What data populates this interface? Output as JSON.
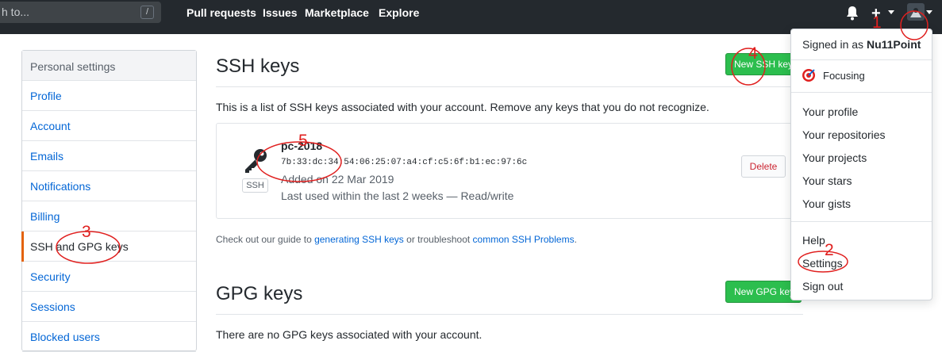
{
  "topbar": {
    "search_placeholder": "h to...",
    "search_shortcut": "/",
    "nav": [
      "Pull requests",
      "Issues",
      "Marketplace",
      "Explore"
    ]
  },
  "sidebar": {
    "heading": "Personal settings",
    "items": [
      "Profile",
      "Account",
      "Emails",
      "Notifications",
      "Billing",
      "SSH and GPG keys",
      "Security",
      "Sessions",
      "Blocked users"
    ],
    "active_index": 5
  },
  "ssh": {
    "title": "SSH keys",
    "new_button": "New SSH key",
    "description": "This is a list of SSH keys associated with your account. Remove any keys that you do not recognize.",
    "key": {
      "badge": "SSH",
      "title": "pc-2018",
      "fingerprint": "7b:33:dc:34:54:06:25:07:a4:cf:c5:6f:b1:ec:97:6c",
      "added": "Added on 22 Mar 2019",
      "last_used": "Last used within the last 2 weeks — Read/write",
      "delete_label": "Delete"
    },
    "guide": {
      "prefix": "Check out our guide to ",
      "link1": "generating SSH keys",
      "middle": " or troubleshoot ",
      "link2": "common SSH Problems",
      "suffix": "."
    }
  },
  "gpg": {
    "title": "GPG keys",
    "new_button": "New GPG key",
    "description": "There are no GPG keys associated with your account."
  },
  "dropdown": {
    "signed_in_prefix": "Signed in as ",
    "username": "Nu11Point",
    "status": "Focusing",
    "group1": [
      "Your profile",
      "Your repositories",
      "Your projects",
      "Your stars",
      "Your gists"
    ],
    "group2": [
      "Help",
      "Settings",
      "Sign out"
    ]
  },
  "annotations": [
    "1",
    "2",
    "3",
    "4",
    "5"
  ],
  "colors": {
    "header_bg": "#24292e",
    "accent_green": "#2cbe4e",
    "link_blue": "#0366d6",
    "active_orange": "#e36209",
    "annotation_red": "#e0201f"
  }
}
